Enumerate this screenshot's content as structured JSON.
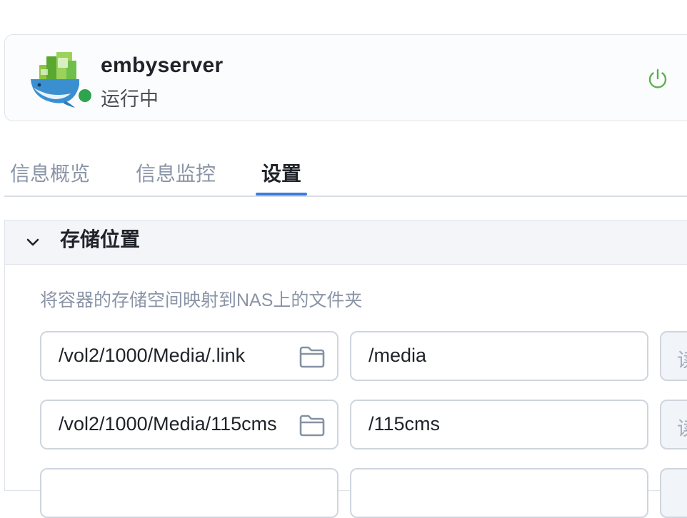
{
  "app": {
    "name": "embyserver",
    "status": "运行中",
    "status_color": "#2ea44f"
  },
  "tabs": [
    {
      "label": "信息概览",
      "active": false
    },
    {
      "label": "信息监控",
      "active": false
    },
    {
      "label": "设置",
      "active": true
    }
  ],
  "accent_color": "#3b7bdf",
  "storage": {
    "title": "存储位置",
    "description": "将容器的存储空间映射到NAS上的文件夹",
    "mappings": [
      {
        "host_path": "/vol2/1000/Media/.link",
        "container_path": "/media",
        "permission": "读"
      },
      {
        "host_path": "/vol2/1000/Media/115cms",
        "container_path": "/115cms",
        "permission": "读"
      },
      {
        "host_path": "",
        "container_path": "",
        "permission": ""
      }
    ]
  },
  "icons": {
    "app": "emby-whale-container-icon",
    "power": "power-icon",
    "collapse": "chevron-down-icon",
    "folder": "folder-icon"
  }
}
